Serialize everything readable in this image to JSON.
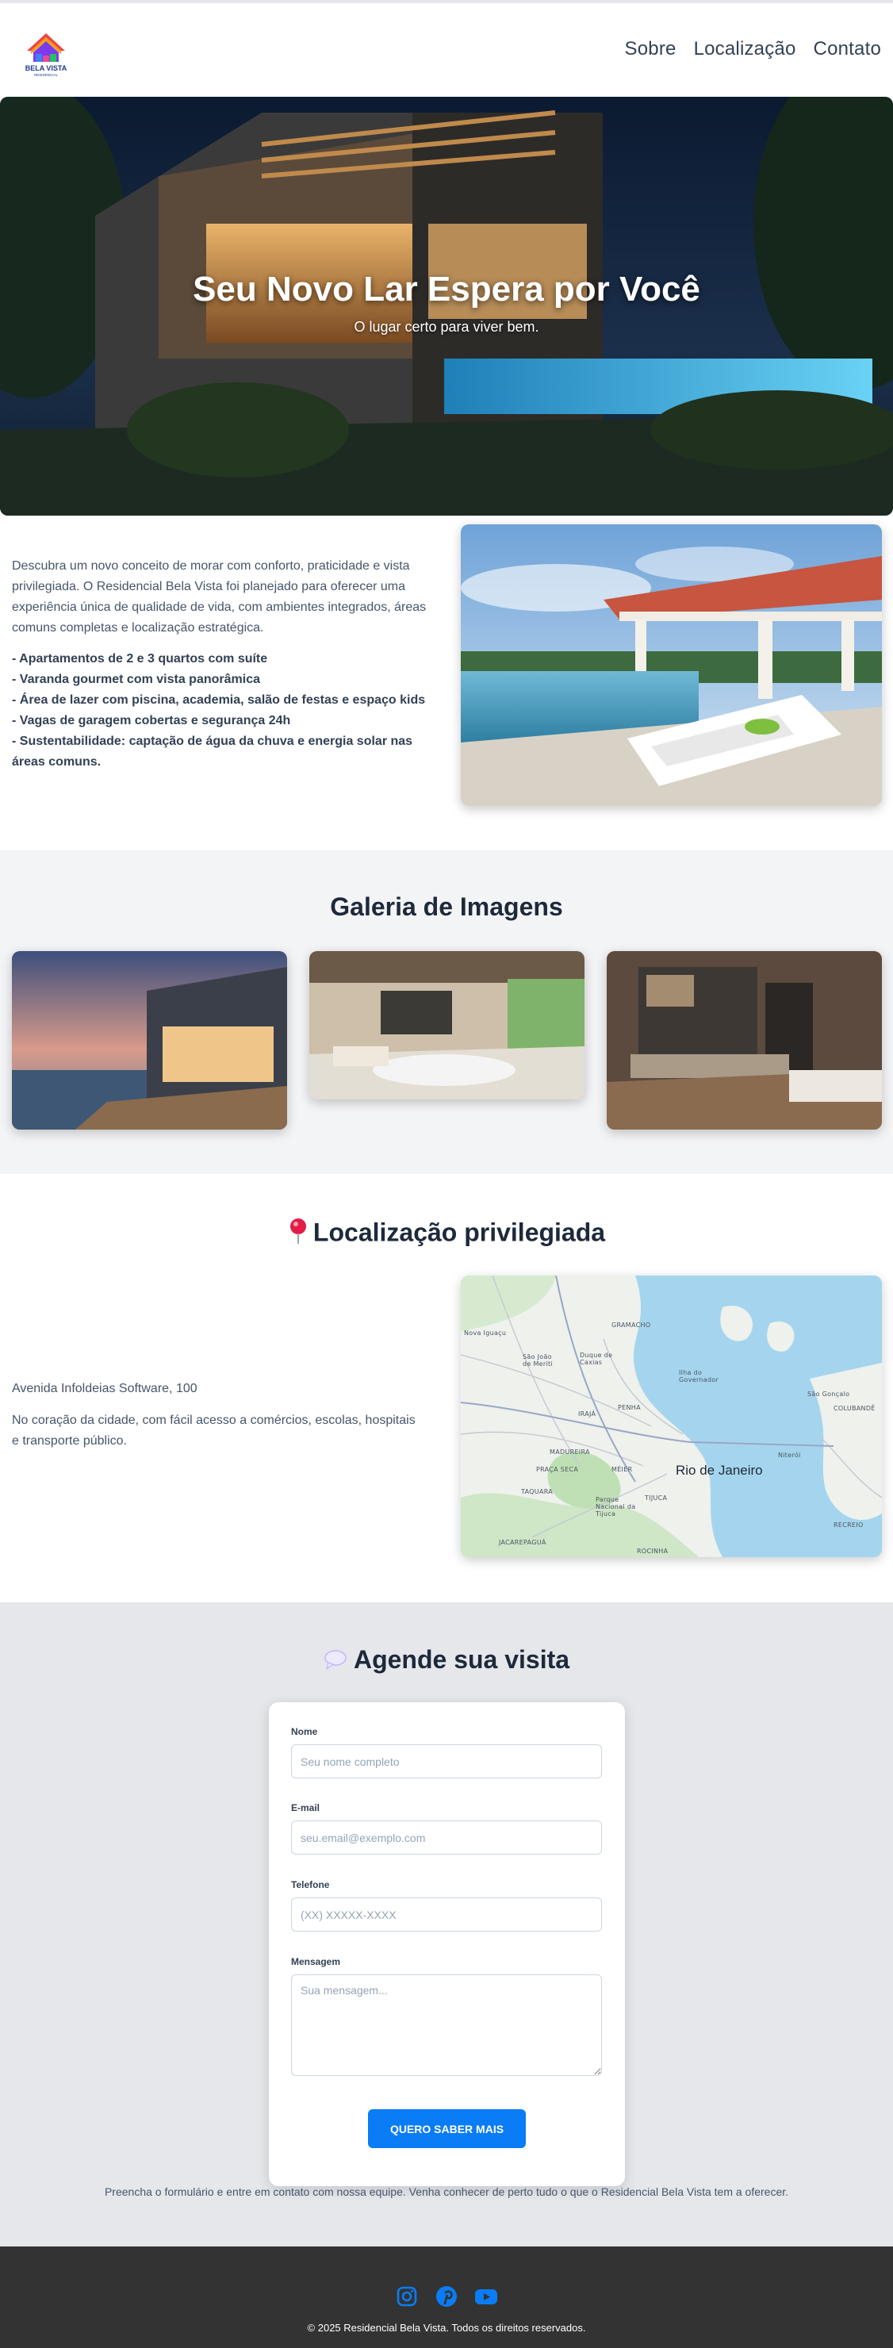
{
  "brand": {
    "logo_line1": "BELA VISTA",
    "logo_line2": "RESIDENCIAL"
  },
  "nav": {
    "items": [
      {
        "label": "Sobre"
      },
      {
        "label": "Localização"
      },
      {
        "label": "Contato"
      }
    ]
  },
  "hero": {
    "title": "Seu Novo Lar Espera por Você",
    "subtitle": "O lugar certo para viver bem."
  },
  "about": {
    "paragraph": "Descubra um novo conceito de morar com conforto, praticidade e vista privilegiada. O Residencial Bela Vista foi planejado para oferecer uma experiência única de qualidade de vida, com ambientes integrados, áreas comuns completas e localização estratégica.",
    "features": [
      "- Apartamentos de 2 e 3 quartos com suíte",
      "- Varanda gourmet com vista panorâmica",
      "- Área de lazer com piscina, academia, salão de festas e espaço kids",
      "- Vagas de garagem cobertas e segurança 24h",
      "- Sustentabilidade: captação de água da chuva e energia solar nas áreas comuns."
    ]
  },
  "gallery": {
    "title": "Galeria de Imagens"
  },
  "location": {
    "title": "Localização privilegiada",
    "icon": "pin-icon",
    "address": "Avenida Infoldeias Software, 100",
    "description": "No coração da cidade, com fácil acesso a comércios, escolas, hospitais e transporte público.",
    "map": {
      "city": "Rio de Janeiro",
      "labels": [
        "Nova Iguaçu",
        "São João de Meriti",
        "Duque de Caxias",
        "GRAMACHO",
        "Ilha do Governador",
        "São Gonçalo",
        "COLUBANDÊ",
        "PENHA",
        "IRAJÁ",
        "MADUREIRA",
        "TIJUCA",
        "TAQUARA",
        "Parque Nacional da Tijuca",
        "Niterói",
        "ROCINHA",
        "JACAREPAGUÁ",
        "PRAÇA SECA",
        "MÉIER",
        "RECREIO"
      ]
    }
  },
  "contact": {
    "title": "Agende sua visita",
    "icon": "speech-bubble-icon",
    "fields": {
      "name_label": "Nome",
      "name_placeholder": "Seu nome completo",
      "email_label": "E-mail",
      "email_placeholder": "seu.email@exemplo.com",
      "phone_label": "Telefone",
      "phone_placeholder": "(XX) XXXXX-XXXX",
      "message_label": "Mensagem",
      "message_placeholder": "Sua mensagem..."
    },
    "submit_label": "QUERO SABER MAIS",
    "note": "Preencha o formulário e entre em contato com nossa equipe. Venha conhecer de perto tudo o que o Residencial Bela Vista tem a oferecer."
  },
  "footer": {
    "socials": [
      "instagram-icon",
      "pinterest-icon",
      "youtube-icon"
    ],
    "copyright": "© 2025 Residencial Bela Vista. Todos os direitos reservados."
  },
  "colors": {
    "accent": "#0a7cf5",
    "footer_bg": "#333333",
    "section_gray": "#f3f4f6",
    "contact_bg": "#e5e7eb"
  }
}
